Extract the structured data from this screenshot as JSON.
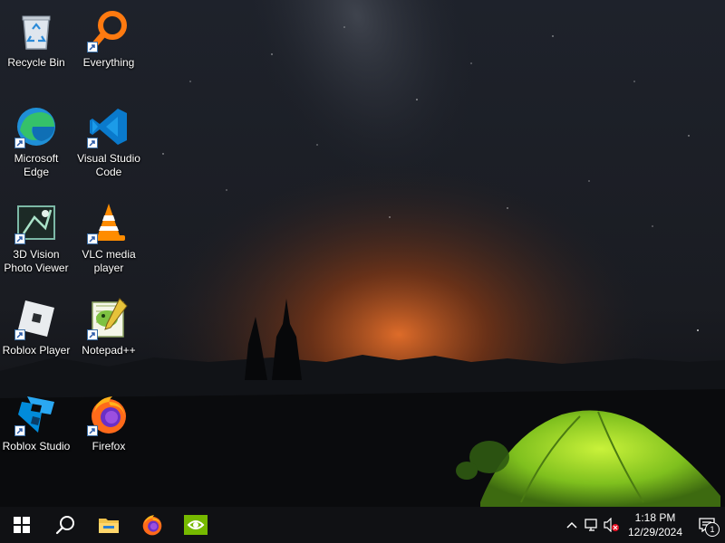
{
  "desktop": {
    "icons": [
      {
        "label": "Recycle Bin",
        "icon": "recycle-bin-icon"
      },
      {
        "label": "Everything",
        "icon": "everything-search-icon"
      },
      {
        "label": "Microsoft Edge",
        "icon": "edge-icon"
      },
      {
        "label": "Visual Studio Code",
        "icon": "vscode-icon"
      },
      {
        "label": "3D Vision Photo Viewer",
        "icon": "3d-vision-icon"
      },
      {
        "label": "VLC media player",
        "icon": "vlc-icon"
      },
      {
        "label": "Roblox Player",
        "icon": "roblox-icon"
      },
      {
        "label": "Notepad++",
        "icon": "notepadpp-icon"
      },
      {
        "label": "Roblox Studio",
        "icon": "roblox-studio-icon"
      },
      {
        "label": "Firefox",
        "icon": "firefox-icon"
      }
    ]
  },
  "taskbar": {
    "pinned": [
      {
        "name": "start-button",
        "icon": "windows-logo-icon"
      },
      {
        "name": "search-button",
        "icon": "search-icon"
      },
      {
        "name": "file-explorer-button",
        "icon": "folder-icon"
      },
      {
        "name": "firefox-taskbar-button",
        "icon": "firefox-icon"
      },
      {
        "name": "nvidia-taskbar-button",
        "icon": "nvidia-icon"
      }
    ],
    "tray": {
      "time": "1:18 PM",
      "date": "12/29/2024",
      "notification_count": "1"
    }
  },
  "colors": {
    "taskbar_bg": "#101114",
    "sky": "#1a1e26",
    "horizon_glow": "#e8702a",
    "tent": "#9fe02a"
  }
}
